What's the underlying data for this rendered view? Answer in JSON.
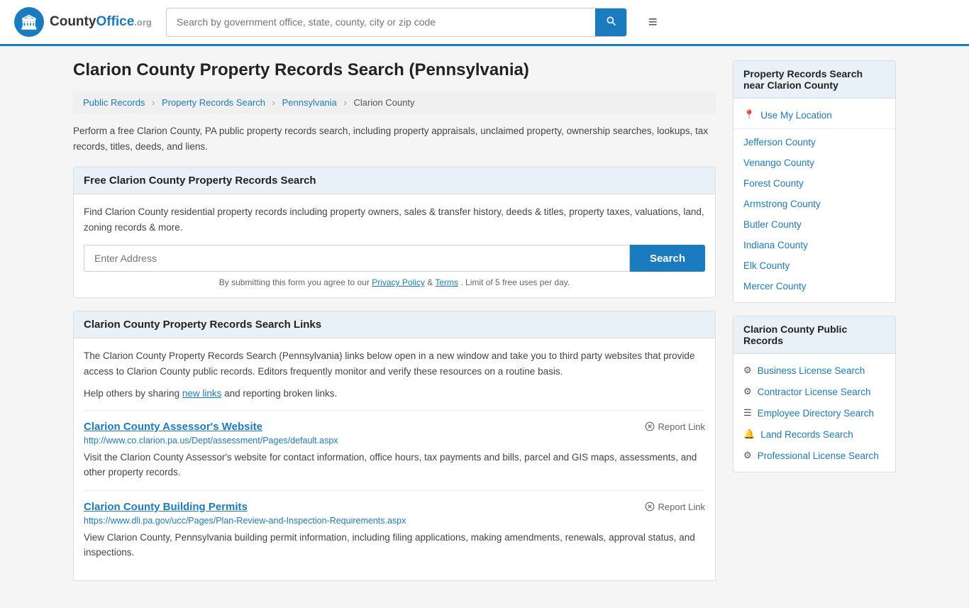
{
  "header": {
    "logo_text": "CountyOffice",
    "logo_org": ".org",
    "search_placeholder": "Search by government office, state, county, city or zip code"
  },
  "page": {
    "title": "Clarion County Property Records Search (Pennsylvania)",
    "breadcrumbs": [
      {
        "label": "Public Records",
        "href": "#"
      },
      {
        "label": "Property Records Search",
        "href": "#"
      },
      {
        "label": "Pennsylvania",
        "href": "#"
      },
      {
        "label": "Clarion County",
        "href": "#"
      }
    ],
    "description": "Perform a free Clarion County, PA public property records search, including property appraisals, unclaimed property, ownership searches, lookups, tax records, titles, deeds, and liens."
  },
  "free_search": {
    "heading": "Free Clarion County Property Records Search",
    "description": "Find Clarion County residential property records including property owners, sales & transfer history, deeds & titles, property taxes, valuations, land, zoning records & more.",
    "address_placeholder": "Enter Address",
    "search_button": "Search",
    "form_note": "By submitting this form you agree to our",
    "privacy_label": "Privacy Policy",
    "terms_label": "Terms",
    "limit_note": ". Limit of 5 free uses per day."
  },
  "links_section": {
    "heading": "Clarion County Property Records Search Links",
    "description": "The Clarion County Property Records Search (Pennsylvania) links below open in a new window and take you to third party websites that provide access to Clarion County public records. Editors frequently monitor and verify these resources on a routine basis.",
    "share_note": "Help others by sharing",
    "new_links_label": "new links",
    "reporting_note": "and reporting broken links.",
    "records": [
      {
        "title": "Clarion County Assessor's Website",
        "url": "http://www.co.clarion.pa.us/Dept/assessment/Pages/default.aspx",
        "description": "Visit the Clarion County Assessor's website for contact information, office hours, tax payments and bills, parcel and GIS maps, assessments, and other property records.",
        "report_label": "Report Link"
      },
      {
        "title": "Clarion County Building Permits",
        "url": "https://www.dli.pa.gov/ucc/Pages/Plan-Review-and-Inspection-Requirements.aspx",
        "description": "View Clarion County, Pennsylvania building permit information, including filing applications, making amendments, renewals, approval status, and inspections.",
        "report_label": "Report Link"
      }
    ]
  },
  "sidebar": {
    "nearby_section": {
      "heading": "Property Records Search near Clarion County",
      "items": [
        {
          "label": "Use My Location",
          "icon": "📍",
          "type": "location"
        },
        {
          "label": "Jefferson County"
        },
        {
          "label": "Venango County"
        },
        {
          "label": "Forest County"
        },
        {
          "label": "Armstrong County"
        },
        {
          "label": "Butler County"
        },
        {
          "label": "Indiana County"
        },
        {
          "label": "Elk County"
        },
        {
          "label": "Mercer County"
        }
      ]
    },
    "public_records_section": {
      "heading": "Clarion County Public Records",
      "items": [
        {
          "label": "Business License Search",
          "icon": "⚙"
        },
        {
          "label": "Contractor License Search",
          "icon": "⚙"
        },
        {
          "label": "Employee Directory Search",
          "icon": "☰"
        },
        {
          "label": "Land Records Search",
          "icon": "🔔"
        },
        {
          "label": "Professional License Search",
          "icon": "⚙"
        }
      ]
    }
  }
}
